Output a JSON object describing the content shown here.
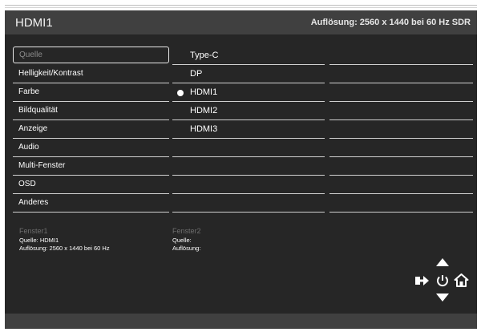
{
  "header": {
    "title": "HDMI1",
    "resolution_info": "Auflösung: 2560 x 1440 bei 60 Hz SDR"
  },
  "menu": {
    "items": [
      {
        "label": "Quelle",
        "selected": true
      },
      {
        "label": "Helligkeit/Kontrast"
      },
      {
        "label": "Farbe"
      },
      {
        "label": "Bildqualität"
      },
      {
        "label": "Anzeige"
      },
      {
        "label": "Audio"
      },
      {
        "label": "Multi-Fenster"
      },
      {
        "label": "OSD"
      },
      {
        "label": "Anderes"
      }
    ]
  },
  "source_options": {
    "items": [
      {
        "label": "Type-C"
      },
      {
        "label": "DP"
      },
      {
        "label": "HDMI1",
        "active": true
      },
      {
        "label": "HDMI2"
      },
      {
        "label": "HDMI3"
      }
    ]
  },
  "window_info": {
    "fenster1": {
      "title": "Fenster1",
      "source": "Quelle: HDMI1",
      "resolution": "Auflösung: 2560 x 1440 bei 60 Hz"
    },
    "fenster2": {
      "title": "Fenster2",
      "source": "Quelle:",
      "resolution": "Auflösung:"
    }
  },
  "nav_icons": [
    "up-arrow-icon",
    "input-icon",
    "power-icon",
    "home-icon",
    "down-arrow-icon"
  ],
  "colors": {
    "panel": "#262626",
    "header": "#404040",
    "text": "#ffffff",
    "muted": "#6e6e6e"
  }
}
